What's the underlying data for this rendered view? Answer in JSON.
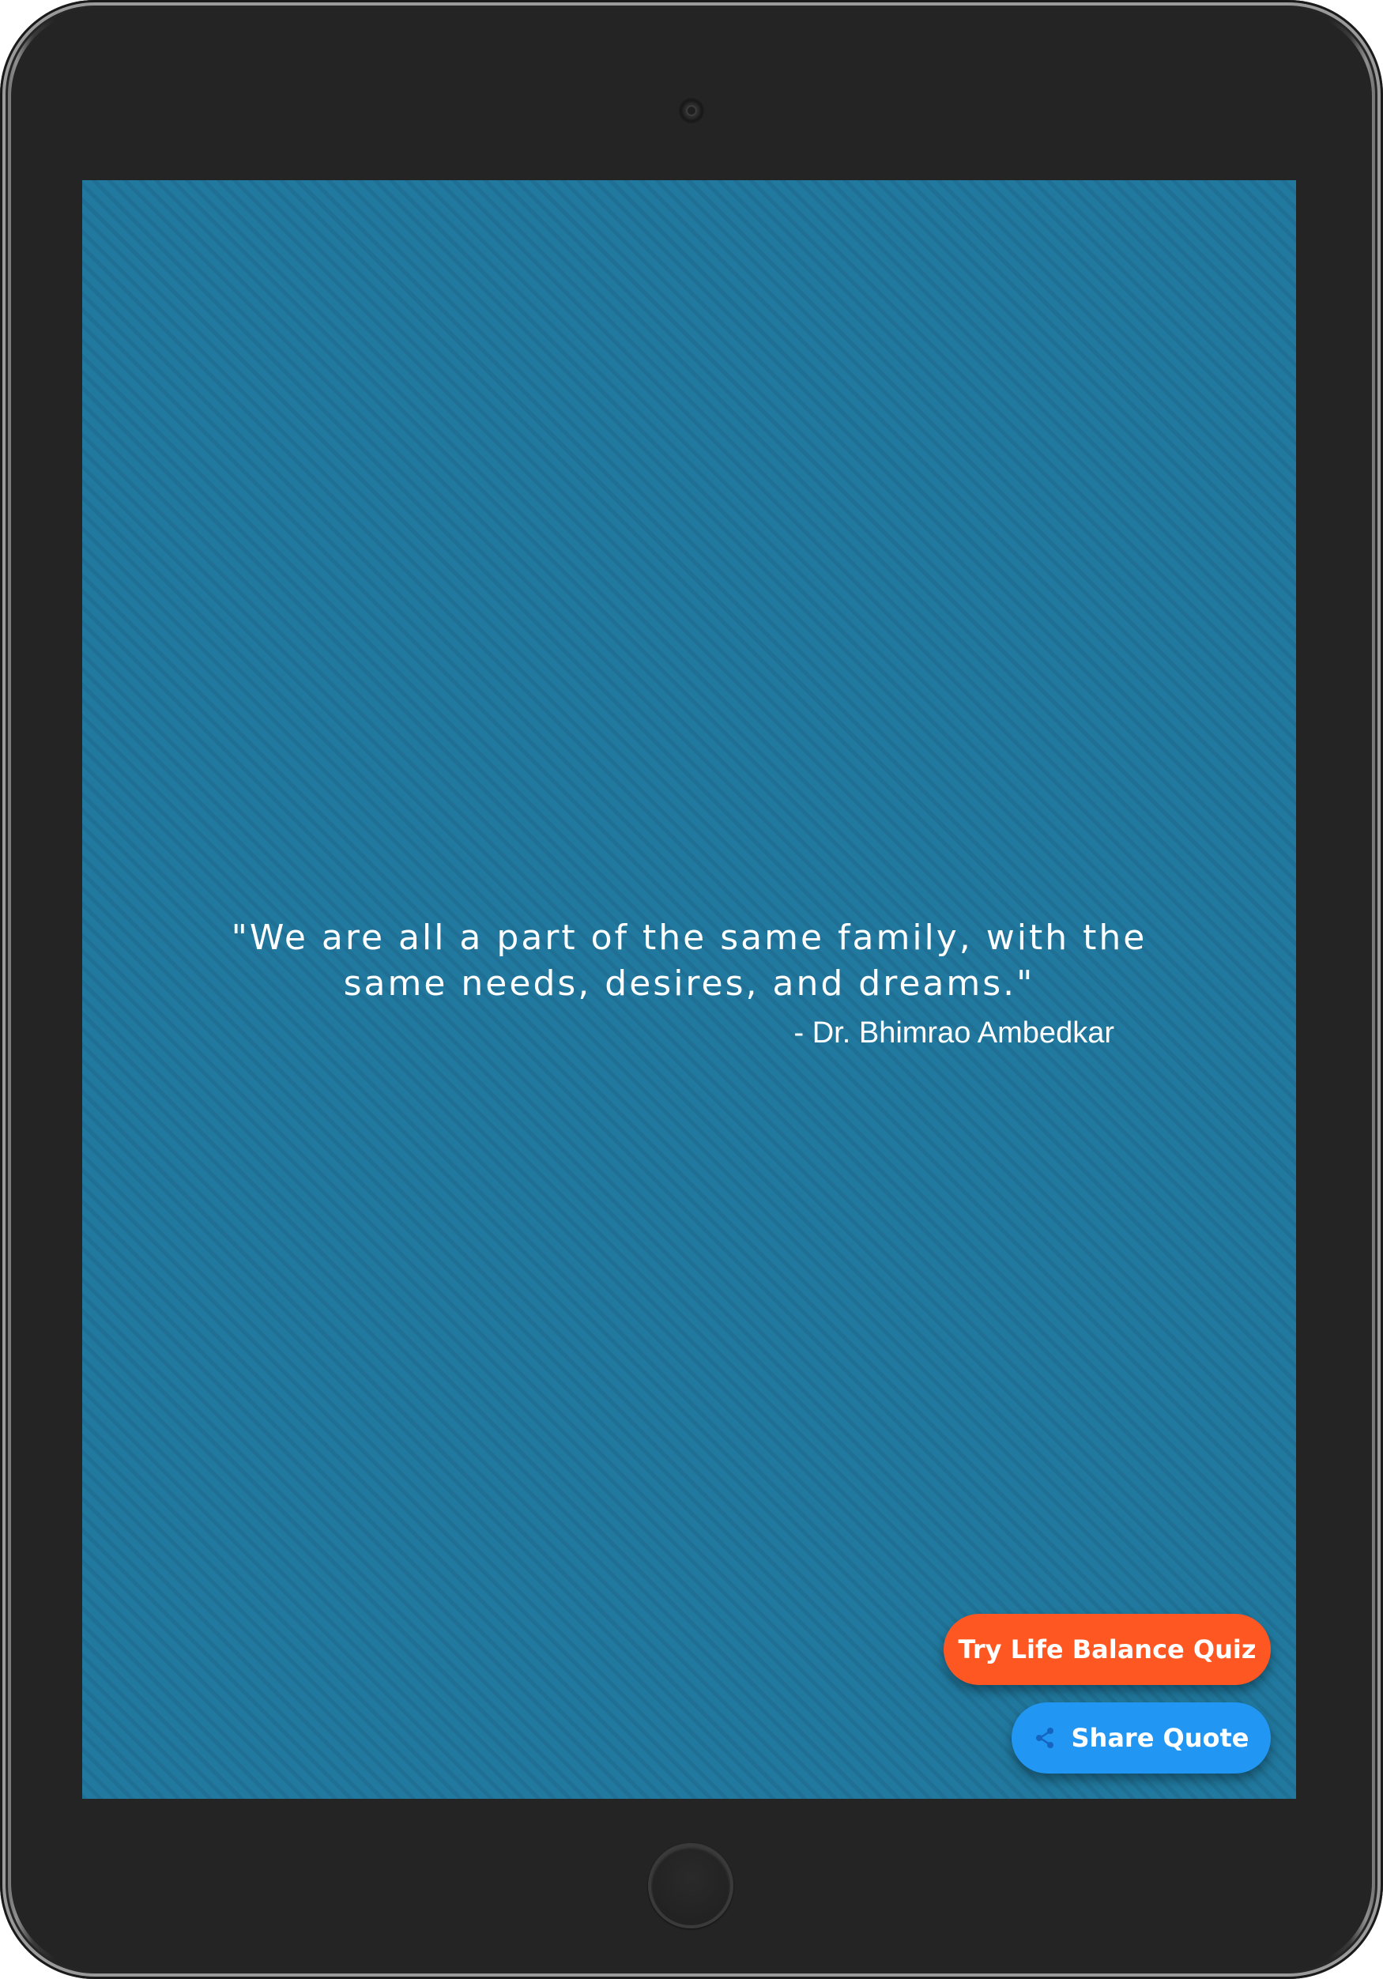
{
  "quote": {
    "text": "\"We are all a part of the same family, with the same needs, desires, and dreams.\"",
    "author": "- Dr. Bhimrao Ambedkar"
  },
  "buttons": {
    "quiz_label": "Try Life Balance Quiz",
    "share_label": "Share Quote",
    "share_icon": "share-icon"
  },
  "colors": {
    "screen_background": "#21799f",
    "quiz_button": "#ff5722",
    "share_button": "#2196f3",
    "text": "#ffffff"
  }
}
